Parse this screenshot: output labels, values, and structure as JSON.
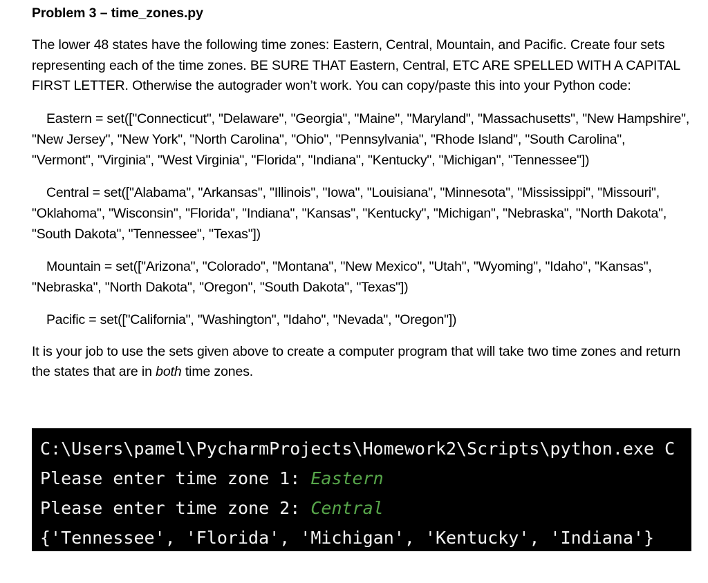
{
  "document": {
    "title": "Problem 3 – time_zones.py",
    "intro": "The lower 48 states have the following time zones: Eastern, Central, Mountain, and Pacific.  Create four sets representing each of the time zones.  BE SURE THAT Eastern, Central, ETC ARE SPELLED WITH A CAPITAL FIRST LETTER.  Otherwise the autograder won’t work.  You can copy/paste this into your Python code:",
    "code_blocks": [
      {
        "name": "eastern",
        "text": "Eastern = set([\"Connecticut\", \"Delaware\", \"Georgia\", \"Maine\", \"Maryland\", \"Massachusetts\", \"New Hampshire\",  \"New Jersey\", \"New York\", \"North Carolina\", \"Ohio\", \"Pennsylvania\", \"Rhode Island\", \"South Carolina\", \"Vermont\", \"Virginia\", \"West Virginia\", \"Florida\", \"Indiana\", \"Kentucky\",  \"Michigan\", \"Tennessee\"])"
      },
      {
        "name": "central",
        "text": "Central = set([\"Alabama\", \"Arkansas\", \"Illinois\", \"Iowa\", \"Louisiana\", \"Minnesota\", \"Mississippi\", \"Missouri\", \"Oklahoma\", \"Wisconsin\", \"Florida\", \"Indiana\", \"Kansas\", \"Kentucky\", \"Michigan\", \"Nebraska\", \"North Dakota\", \"South Dakota\", \"Tennessee\", \"Texas\"])"
      },
      {
        "name": "mountain",
        "text": "Mountain = set([\"Arizona\", \"Colorado\", \"Montana\", \"New Mexico\", \"Utah\", \"Wyoming\", \"Idaho\", \"Kansas\",  \"Nebraska\", \"North Dakota\", \"Oregon\", \"South Dakota\", \"Texas\"])"
      },
      {
        "name": "pacific",
        "text": "Pacific = set([\"California\", \"Washington\", \"Idaho\", \"Nevada\", \"Oregon\"])"
      }
    ],
    "closing": {
      "part1": "It is your job to use the sets given above to create a computer program that will take two time zones and return the states that are in ",
      "emphasis": "both",
      "part2": " time zones."
    }
  },
  "terminal": {
    "background_color": "#000000",
    "text_color": "#f2f2f2",
    "input_color": "#57a64a",
    "lines": [
      {
        "name": "command-line",
        "prompt": "C:\\Users\\pamel\\PycharmProjects\\Homework2\\Scripts\\python.exe C",
        "input": ""
      },
      {
        "name": "prompt-zone-1",
        "prompt": "Please enter time zone 1: ",
        "input": "Eastern"
      },
      {
        "name": "prompt-zone-2",
        "prompt": "Please enter time zone 2: ",
        "input": "Central"
      },
      {
        "name": "result-output",
        "prompt": "{'Tennessee', 'Florida', 'Michigan', 'Kentucky', 'Indiana'}",
        "input": ""
      }
    ]
  }
}
